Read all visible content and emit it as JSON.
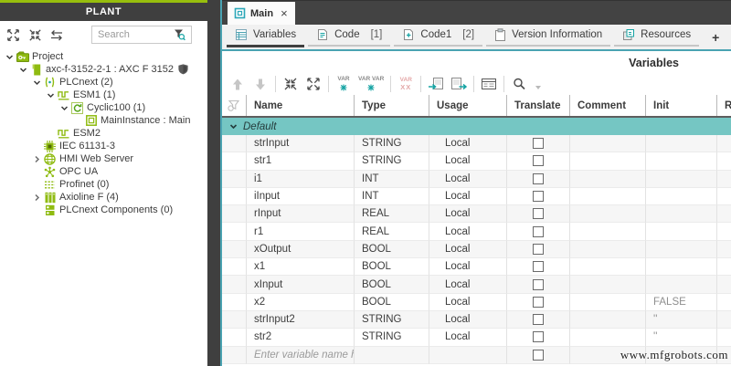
{
  "plant": {
    "title": "PLANT",
    "search": {
      "placeholder": "Search"
    },
    "tree": [
      {
        "label": "Project",
        "icon": "project-folder-icon",
        "level": 0,
        "state": "expanded"
      },
      {
        "label": "axc-f-3152-2-1 : AXC F 3152",
        "icon": "plc-device-icon",
        "level": 1,
        "state": "expanded",
        "badge": "shield-icon"
      },
      {
        "label": "PLCnext (2)",
        "icon": "plcnext-icon",
        "level": 2,
        "state": "expanded"
      },
      {
        "label": "ESM1 (1)",
        "icon": "esm-task-icon",
        "level": 3,
        "state": "expanded"
      },
      {
        "label": "Cyclic100 (1)",
        "icon": "cyclic-task-icon",
        "level": 4,
        "state": "expanded"
      },
      {
        "label": "MainInstance : Main",
        "icon": "program-instance-icon",
        "level": 5,
        "state": "none"
      },
      {
        "label": "ESM2",
        "icon": "esm-task-icon",
        "level": 3,
        "state": "none"
      },
      {
        "label": "IEC 61131-3",
        "icon": "iec-61131-icon",
        "level": 2,
        "state": "none"
      },
      {
        "label": "HMI Web Server",
        "icon": "hmi-webserver-icon",
        "level": 2,
        "state": "collapsed"
      },
      {
        "label": "OPC UA",
        "icon": "opc-ua-icon",
        "level": 2,
        "state": "none"
      },
      {
        "label": "Profinet (0)",
        "icon": "profinet-icon",
        "level": 2,
        "state": "none"
      },
      {
        "label": "Axioline F (4)",
        "icon": "axioline-icon",
        "level": 2,
        "state": "collapsed"
      },
      {
        "label": "PLCnext Components (0)",
        "icon": "plcnext-components-icon",
        "level": 2,
        "state": "none"
      }
    ]
  },
  "editor": {
    "window_tab": {
      "title": "Main",
      "close_label": "×"
    },
    "doc_tabs": [
      {
        "label": "Variables",
        "count": ""
      },
      {
        "label": "Code",
        "count": "[1]"
      },
      {
        "label": "Code1",
        "count": "[2]"
      },
      {
        "label": "Version Information",
        "count": ""
      },
      {
        "label": "Resources",
        "count": ""
      }
    ],
    "new_tab_label": "+",
    "section_title": "Variables",
    "toolbar": {
      "var_text": "VAR",
      "var_pair_text": "VAR VAR",
      "delete_text": "XX"
    }
  },
  "table": {
    "columns": {
      "name": "Name",
      "type": "Type",
      "usage": "Usage",
      "translate": "Translate",
      "comment": "Comment",
      "init": "Init",
      "retain": "R"
    },
    "group_label": "Default",
    "rows": [
      {
        "name": "strInput",
        "type": "STRING",
        "usage": "Local",
        "comment": "",
        "init": ""
      },
      {
        "name": "str1",
        "type": "STRING",
        "usage": "Local",
        "comment": "",
        "init": ""
      },
      {
        "name": "i1",
        "type": "INT",
        "usage": "Local",
        "comment": "",
        "init": ""
      },
      {
        "name": "iInput",
        "type": "INT",
        "usage": "Local",
        "comment": "",
        "init": ""
      },
      {
        "name": "rInput",
        "type": "REAL",
        "usage": "Local",
        "comment": "",
        "init": ""
      },
      {
        "name": "r1",
        "type": "REAL",
        "usage": "Local",
        "comment": "",
        "init": ""
      },
      {
        "name": "xOutput",
        "type": "BOOL",
        "usage": "Local",
        "comment": "",
        "init": ""
      },
      {
        "name": "x1",
        "type": "BOOL",
        "usage": "Local",
        "comment": "",
        "init": ""
      },
      {
        "name": "xInput",
        "type": "BOOL",
        "usage": "Local",
        "comment": "",
        "init": ""
      },
      {
        "name": "x2",
        "type": "BOOL",
        "usage": "Local",
        "comment": "",
        "init": "FALSE"
      },
      {
        "name": "strInput2",
        "type": "STRING",
        "usage": "Local",
        "comment": "",
        "init": "''"
      },
      {
        "name": "str2",
        "type": "STRING",
        "usage": "Local",
        "comment": "",
        "init": "''"
      }
    ],
    "new_row_placeholder": "Enter variable name here"
  },
  "watermark": "www.mfgrobots.com",
  "colors": {
    "brand_green": "#97be0d",
    "teal_accent": "#14a3a3",
    "tab_line_teal": "#4aa3b2",
    "group_row_teal": "#75c6c3",
    "chrome_dark": "#3f3f3f",
    "disabled_pink": "#e4a7a7",
    "disabled_gray": "#c6c6c6"
  }
}
